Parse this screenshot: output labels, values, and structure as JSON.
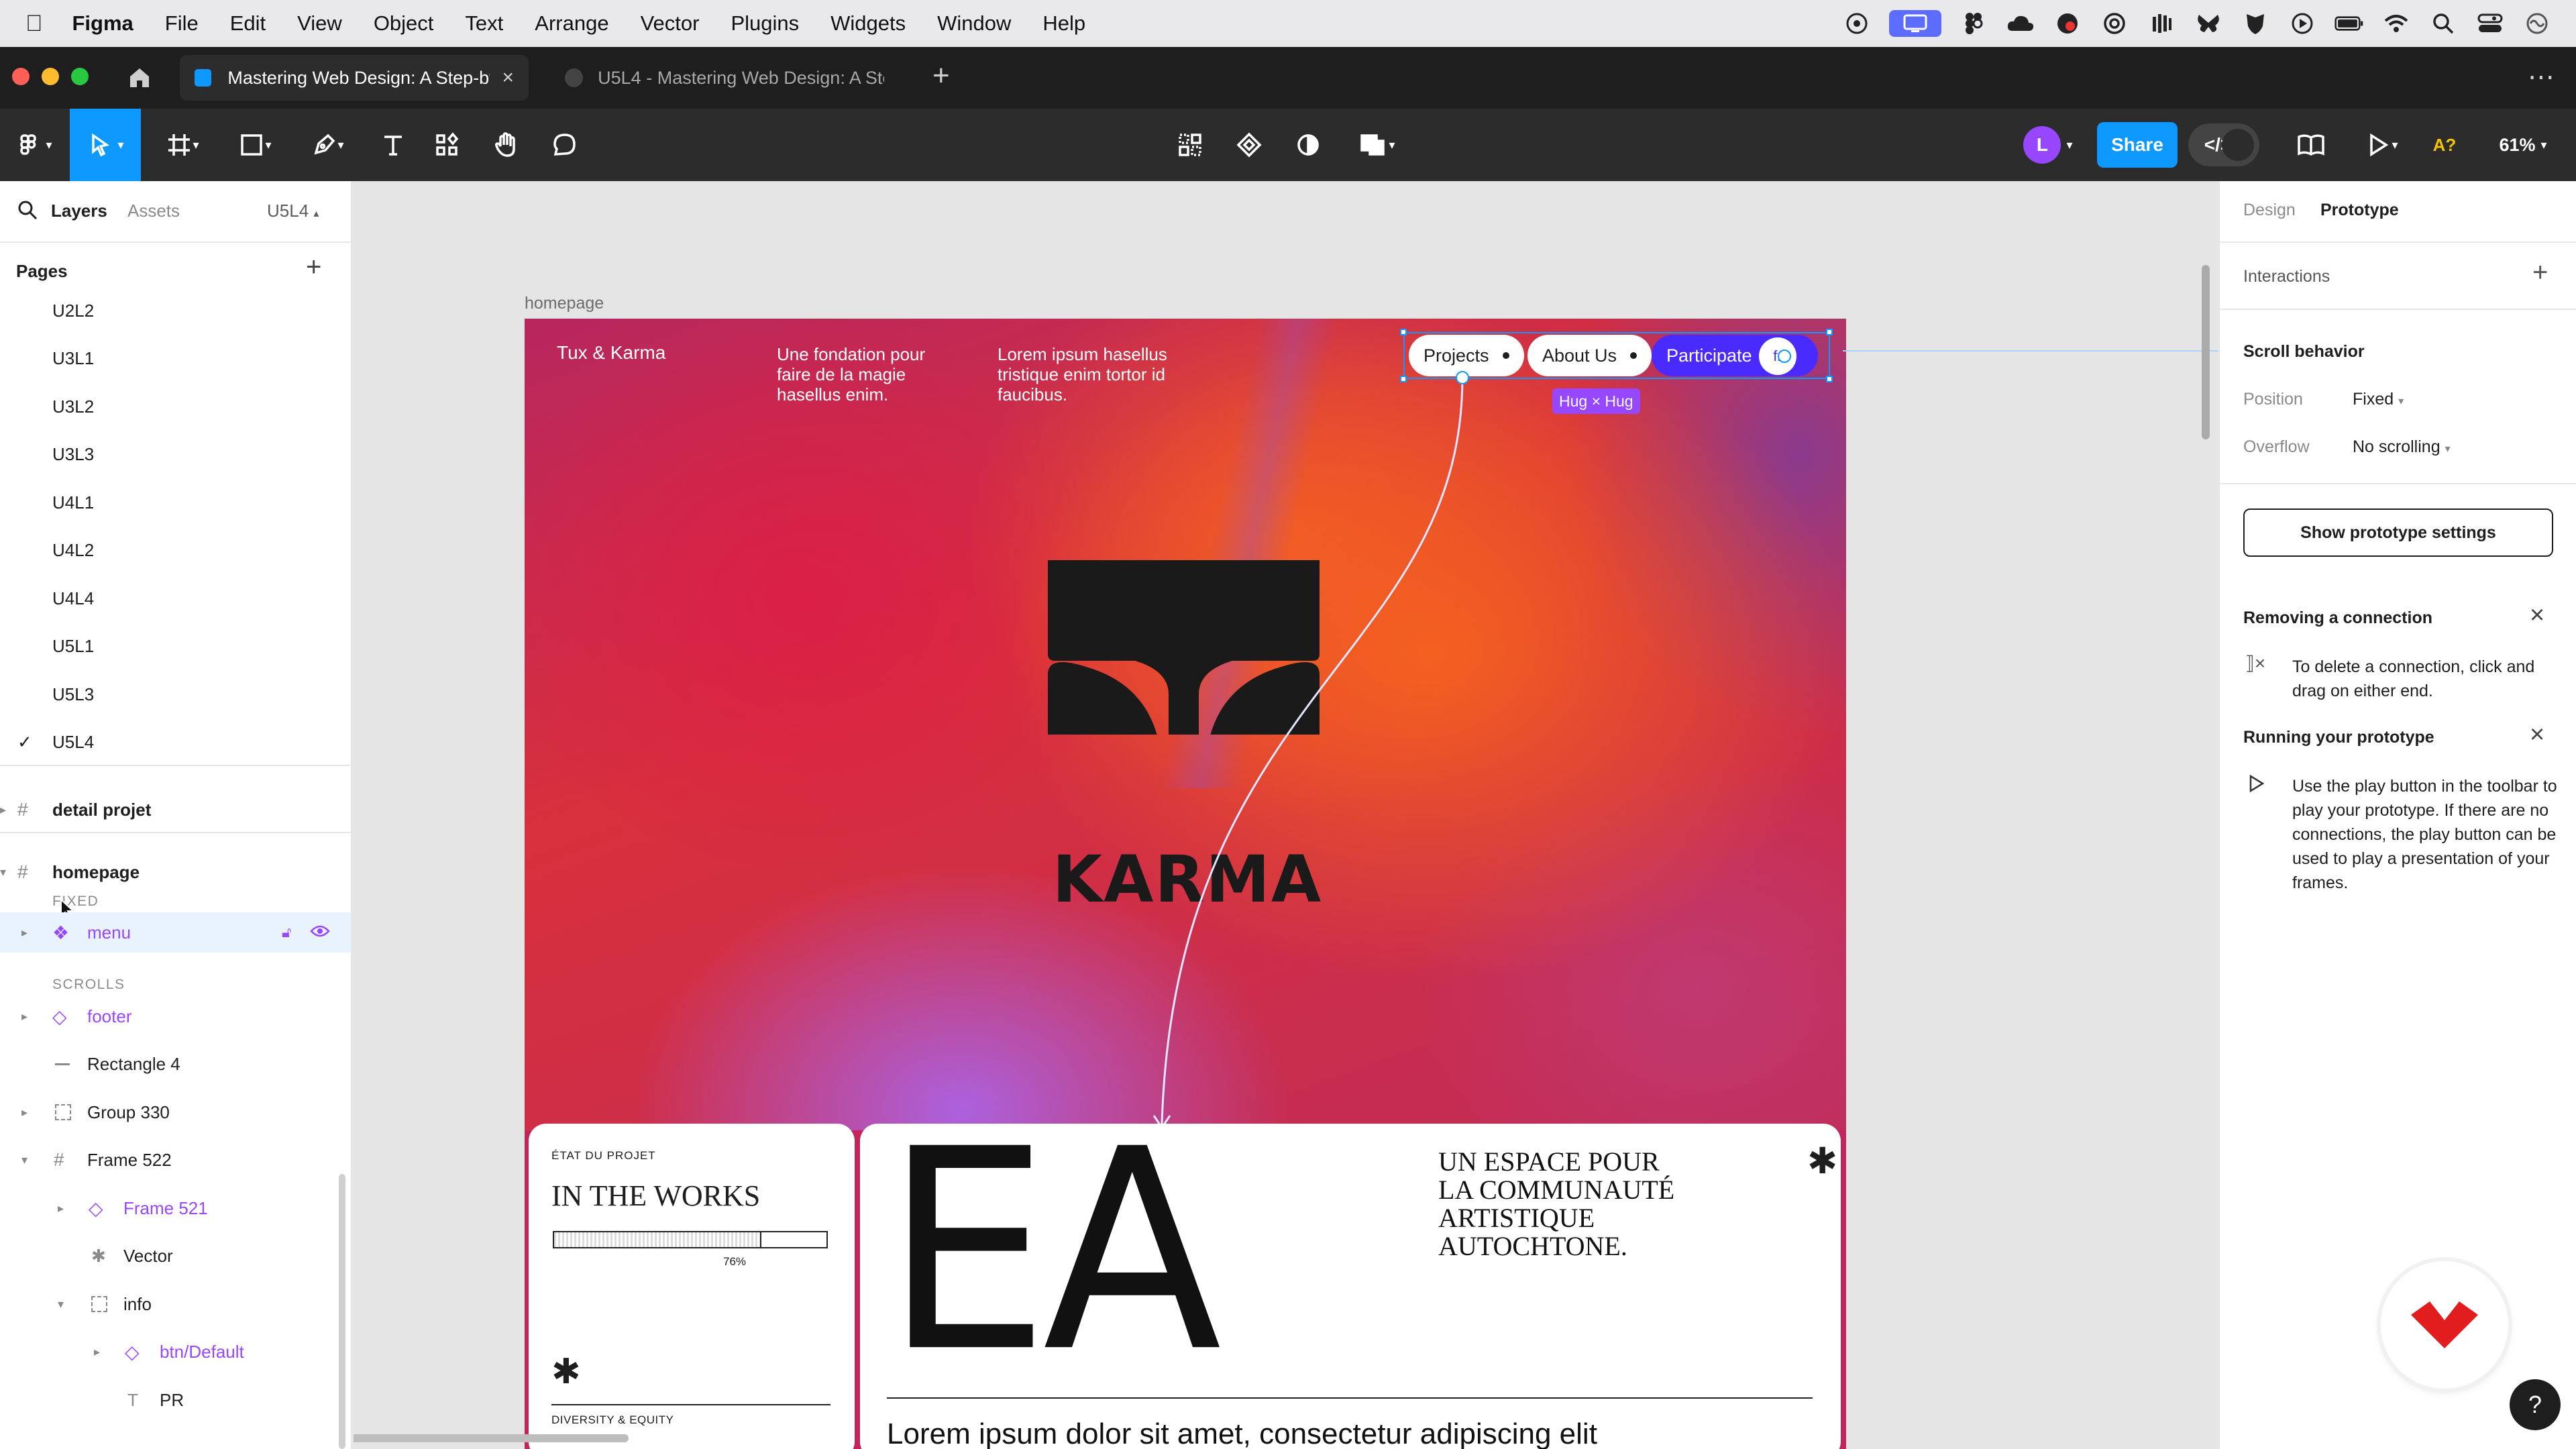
{
  "menubar": {
    "app": "Figma",
    "items": [
      "File",
      "Edit",
      "View",
      "Object",
      "Text",
      "Arrange",
      "Vector",
      "Plugins",
      "Widgets",
      "Window",
      "Help"
    ]
  },
  "tabs": {
    "active": "Mastering Web Design: A Step-by-",
    "inactive": "U5L4 - Mastering Web Design: A Ste"
  },
  "toolbar": {
    "avatar_initial": "L",
    "share_label": "Share",
    "zoom": "61%"
  },
  "leftpanel": {
    "tab_layers": "Layers",
    "tab_assets": "Assets",
    "page_switcher": "U5L4",
    "pages_header": "Pages",
    "pages": [
      "U2L2",
      "U3L1",
      "U3L2",
      "U3L3",
      "U4L1",
      "U4L2",
      "U4L4",
      "U5L1",
      "U5L3",
      "U5L4"
    ],
    "frames": [
      "detail projet",
      "homepage"
    ],
    "section_fixed": "FIXED",
    "section_scrolls": "SCROLLS",
    "layers": {
      "menu": "menu",
      "footer": "footer",
      "rect": "Rectangle 4",
      "group": "Group 330",
      "frame522": "Frame 522",
      "frame521": "Frame 521",
      "vector": "Vector",
      "info": "info",
      "btn": "btn/Default",
      "pr": "PR"
    }
  },
  "canvas": {
    "frame_label": "homepage",
    "brand": "Tux & Karma",
    "col1": "Une fondation pour faire de la magie hasellus enim.",
    "col2": "Lorem ipsum hasellus tristique enim tortor id faucibus.",
    "nav": [
      "Projects",
      "About Us",
      "Participate"
    ],
    "hug_label": "Hug × Hug",
    "logo_text": "KARMA",
    "card_status_label": "ÉTAT DU PROJET",
    "card_status_title": "IN THE WORKS",
    "progress_value": "76%",
    "progress": 0.76,
    "card_footer": "DIVERSITY & EQUITY",
    "big_letters": "EA",
    "tagline": "UN ESPACE POUR LA COMMUNAUTÉ ARTISTIQUE AUTOCHTONE.",
    "lorem_partial": "Lorem ipsum dolor sit amet, consectetur adipiscing elit"
  },
  "rightpanel": {
    "tab_design": "Design",
    "tab_prototype": "Prototype",
    "interactions": "Interactions",
    "scroll_behavior": "Scroll behavior",
    "position_label": "Position",
    "position_value": "Fixed",
    "overflow_label": "Overflow",
    "overflow_value": "No scrolling",
    "show_settings": "Show prototype settings",
    "removing_title": "Removing a connection",
    "removing_text": "To delete a connection, click and drag on either end.",
    "running_title": "Running your prototype",
    "running_text": "Use the play button in the toolbar to play your prototype. If there are no connections, the play button can be used to play a presentation of your frames."
  },
  "help_label": "?",
  "colors": {
    "accent": "#0d99ff",
    "component": "#9747ff",
    "participate": "#4a2bff",
    "brand_logo": "#e11d1d"
  }
}
